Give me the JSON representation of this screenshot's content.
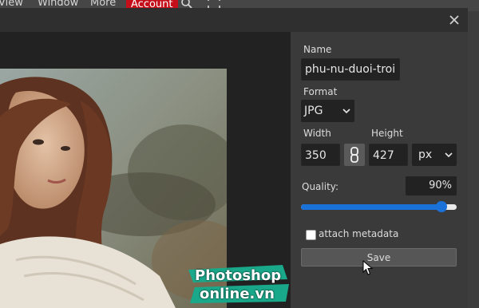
{
  "menu": {
    "items": [
      "View",
      "Window",
      "More"
    ],
    "account_label": "Account",
    "icons": [
      "search-icon",
      "fullscreen-icon"
    ],
    "account_color": "#c40f1a"
  },
  "dialog": {
    "close_icon": "close-icon",
    "name": {
      "label": "Name",
      "value": "phu-nu-duoi-troi"
    },
    "format": {
      "label": "Format",
      "value": "JPG"
    },
    "width": {
      "label": "Width",
      "value": "350"
    },
    "height": {
      "label": "Height",
      "value": "427"
    },
    "unit": {
      "value": "px"
    },
    "quality": {
      "label": "Quality:",
      "value": "90%",
      "fraction": 0.9
    },
    "metadata": {
      "label": "attach metadata",
      "checked": false
    },
    "save_label": "Save",
    "accent_color": "#1a72d8"
  },
  "watermark": {
    "line1": "Photoshop",
    "line2": "online.vn"
  }
}
